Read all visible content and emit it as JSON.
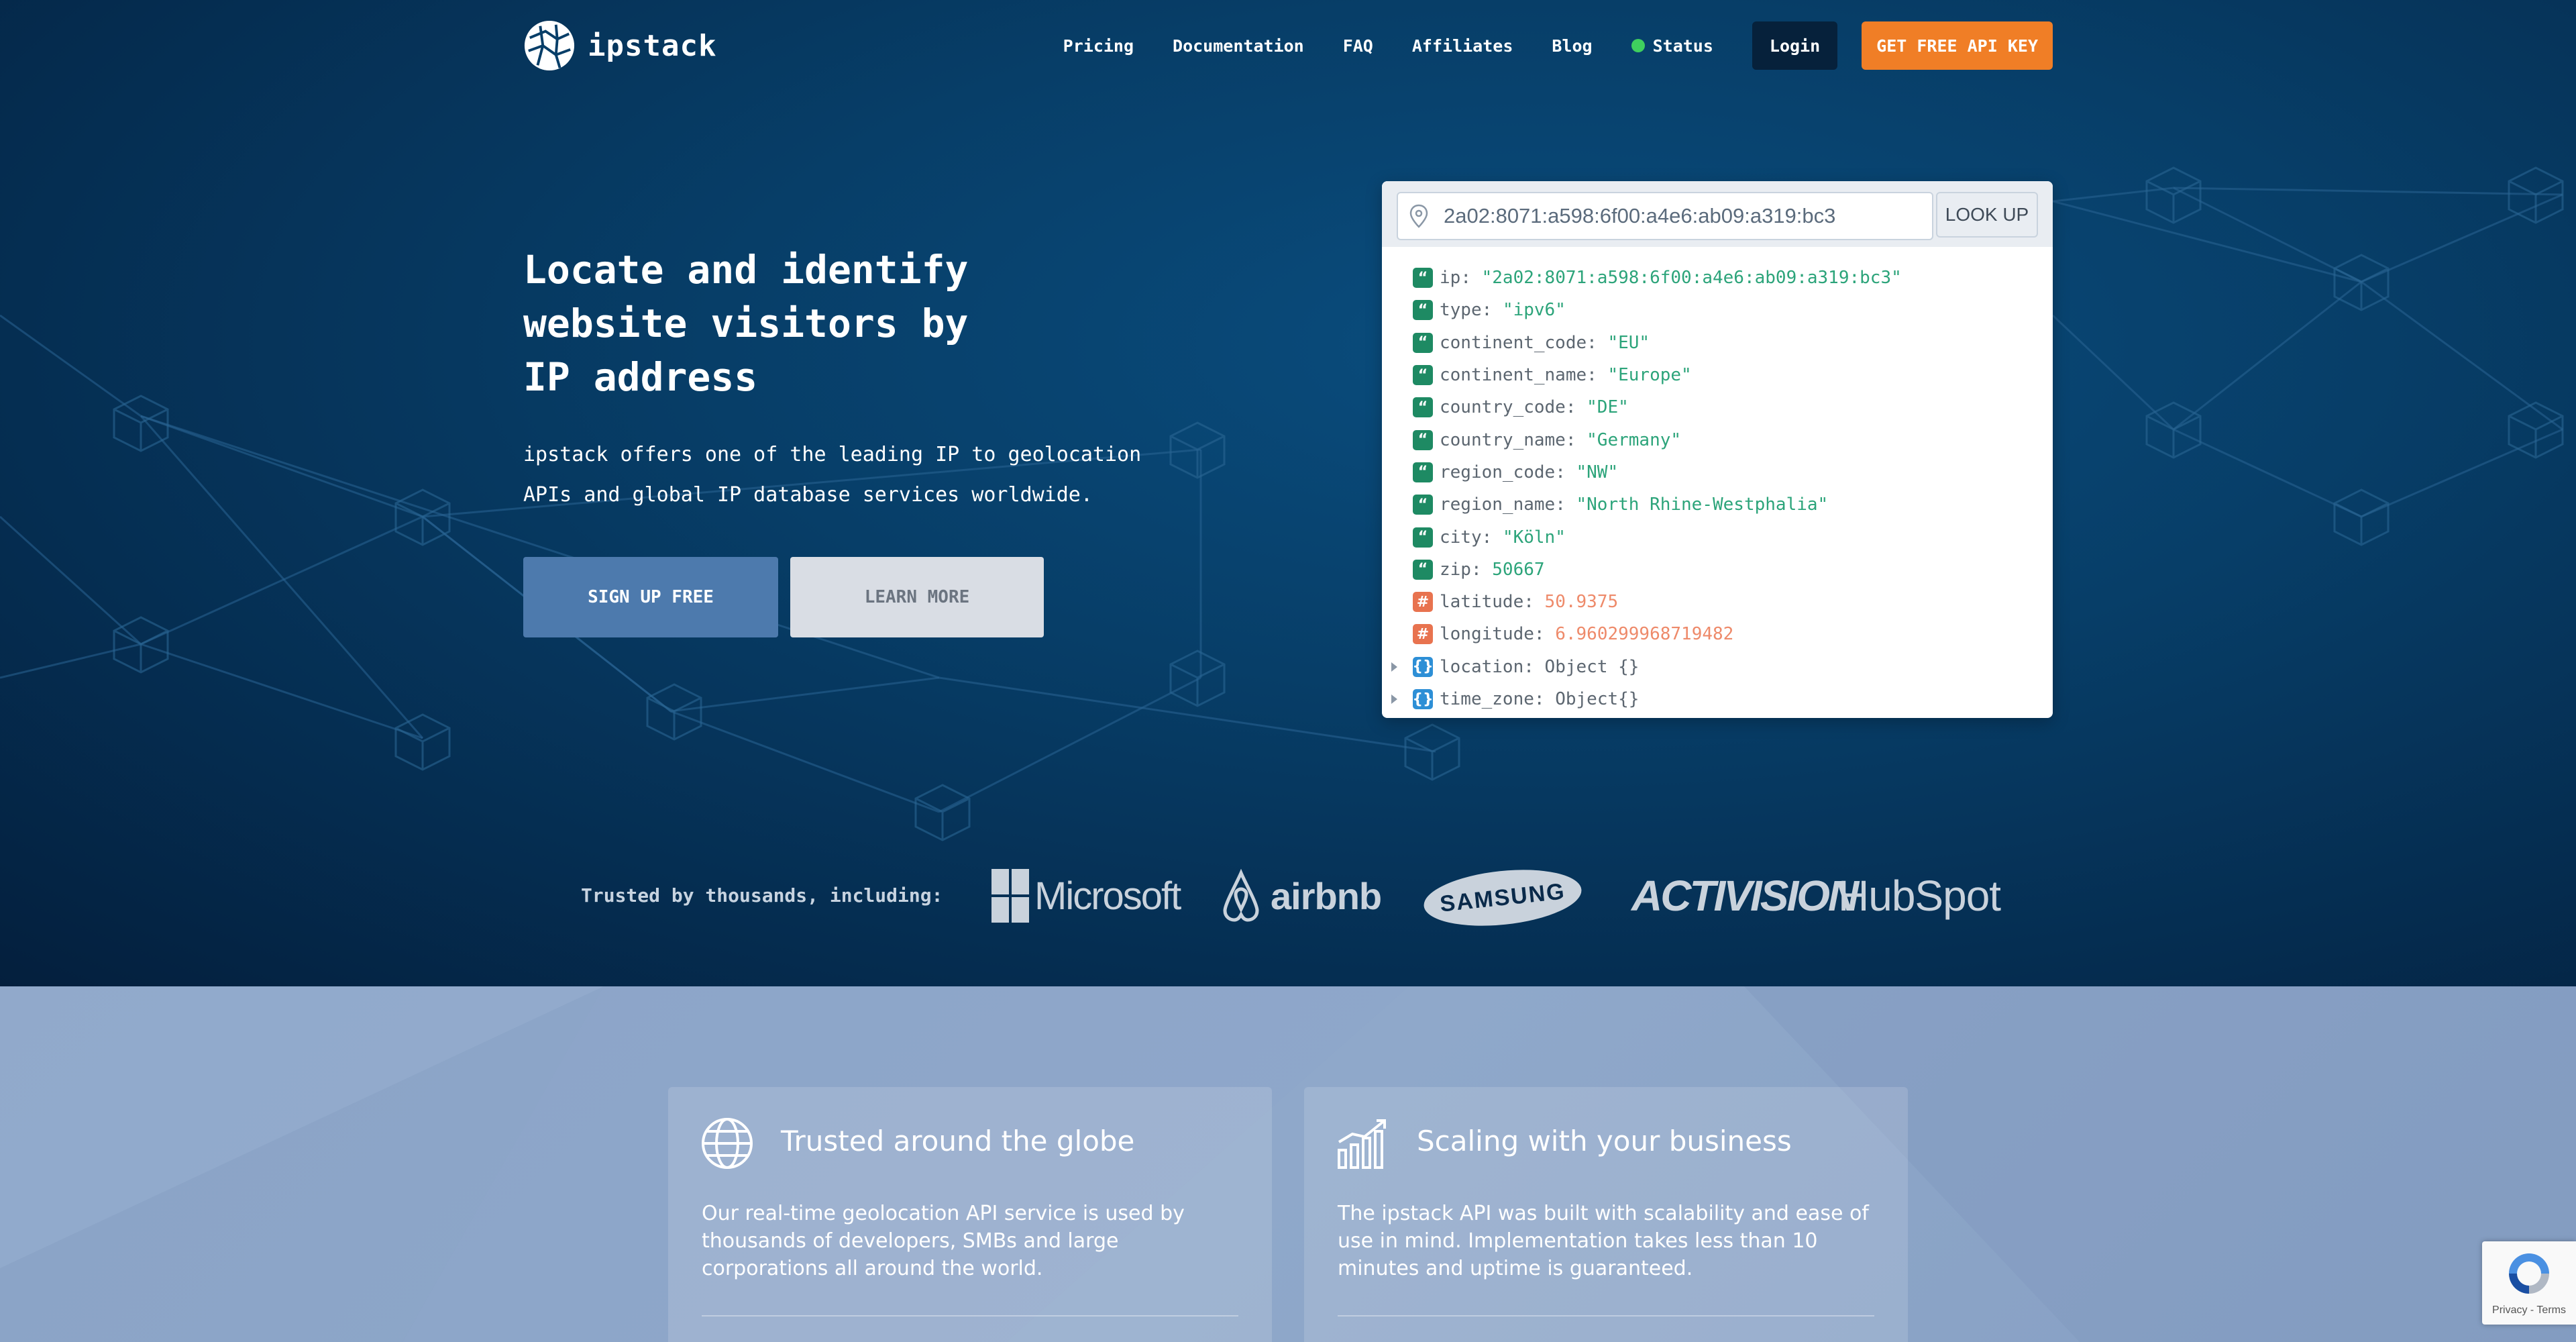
{
  "nav": {
    "brand": "ipstack",
    "links": [
      {
        "label": "Pricing"
      },
      {
        "label": "Documentation"
      },
      {
        "label": "FAQ"
      },
      {
        "label": "Affiliates"
      },
      {
        "label": "Blog"
      }
    ],
    "status_label": "Status",
    "login_label": "Login",
    "cta_label": "GET FREE API KEY"
  },
  "hero": {
    "headline_lines": [
      "Locate and identify",
      "website visitors by",
      "IP address"
    ],
    "subtext_lines": [
      "ipstack offers one of the leading IP to geolocation",
      "APIs and global IP database services worldwide."
    ],
    "signup_label": "SIGN UP FREE",
    "learn_label": "LEARN MORE"
  },
  "lookup": {
    "ip_value": "2a02:8071:a598:6f00:a4e6:ab09:a319:bc3",
    "button_label": "LOOK UP",
    "rows": [
      {
        "key": "ip",
        "value": "\"2a02:8071:a598:6f00:a4e6:ab09:a319:bc3\"",
        "type": "string",
        "icon": "string-icon"
      },
      {
        "key": "type",
        "value": "\"ipv6\"",
        "type": "string",
        "icon": "string-icon"
      },
      {
        "key": "continent_code",
        "value": "\"EU\"",
        "type": "string",
        "icon": "string-icon"
      },
      {
        "key": "continent_name",
        "value": "\"Europe\"",
        "type": "string",
        "icon": "string-icon"
      },
      {
        "key": "country_code",
        "value": "\"DE\"",
        "type": "string",
        "icon": "string-icon"
      },
      {
        "key": "country_name",
        "value": "\"Germany\"",
        "type": "string",
        "icon": "string-icon"
      },
      {
        "key": "region_code",
        "value": "\"NW\"",
        "type": "string",
        "icon": "string-icon"
      },
      {
        "key": "region_name",
        "value": "\"North Rhine-Westphalia\"",
        "type": "string",
        "icon": "string-icon"
      },
      {
        "key": "city",
        "value": "\"Köln\"",
        "type": "string",
        "icon": "string-icon"
      },
      {
        "key": "zip",
        "value": "50667",
        "type": "string",
        "icon": "string-icon"
      },
      {
        "key": "latitude",
        "value": "50.9375",
        "type": "number",
        "icon": "number-icon"
      },
      {
        "key": "longitude",
        "value": "6.960299968719482",
        "type": "number",
        "icon": "number-icon"
      },
      {
        "key": "location",
        "value": "Object {}",
        "type": "object",
        "icon": "object-icon"
      },
      {
        "key": "time_zone",
        "value": "Object{}",
        "type": "object",
        "icon": "object-icon"
      }
    ]
  },
  "trusted": {
    "label": "Trusted by thousands, including:",
    "brands": [
      "Microsoft",
      "airbnb",
      "SAMSUNG",
      "ACTIVISION",
      "HubSpot"
    ]
  },
  "features": [
    {
      "icon": "globe-icon",
      "title": "Trusted around the globe",
      "body": "Our real-time geolocation API service is used by thousands of developers, SMBs and large corporations all around the world."
    },
    {
      "icon": "growth-chart-icon",
      "title": "Scaling with your business",
      "body": "The ipstack API was built with scalability and ease of use in mind. Implementation takes less than 10 minutes and uptime is guaranteed."
    }
  ],
  "recaptcha": {
    "terms": "Privacy - Terms"
  },
  "colors": {
    "accent_orange": "#f07e26",
    "hero_dark": "#052e52",
    "json_string": "#2ca47a",
    "json_number": "#ee8a6a",
    "status_green": "#3fcf5e"
  }
}
